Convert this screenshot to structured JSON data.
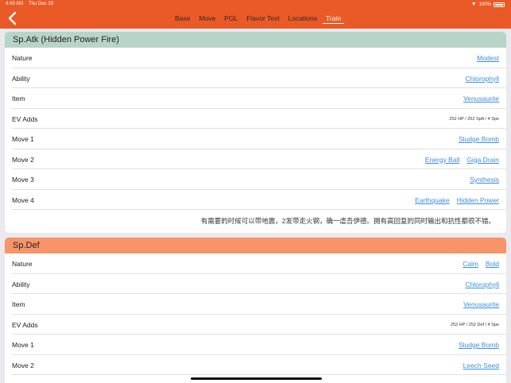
{
  "status": {
    "time": "4:43 AM",
    "date": "Thu Dec 19",
    "battery": "100%"
  },
  "nav": {
    "tabs": [
      "Base",
      "Move",
      "PGL",
      "Flavor Text",
      "Locations",
      "Train"
    ],
    "active_tab": "Train"
  },
  "colors": {
    "accent": "#ea5a26",
    "header_spatk": "#b7d4c9",
    "header_spdef": "#f7946a",
    "link": "#3a8ee0"
  },
  "builds": [
    {
      "title": "Sp.Atk (Hidden Power Fire)",
      "rows": [
        {
          "label": "Nature",
          "values": [
            "Modest"
          ]
        },
        {
          "label": "Ability",
          "values": [
            "Chlorophyll"
          ]
        },
        {
          "label": "Item",
          "values": [
            "Venusaurite"
          ]
        },
        {
          "label": "EV Adds",
          "ev": "252 HP / 252 SpA / 4 Spe"
        },
        {
          "label": "Move 1",
          "values": [
            "Sludge Bomb"
          ]
        },
        {
          "label": "Move 2",
          "values": [
            "Energy Ball",
            "Giga Drain"
          ]
        },
        {
          "label": "Move 3",
          "values": [
            "Synthesis"
          ]
        },
        {
          "label": "Move 4",
          "values": [
            "Earthquake",
            "Hidden Power"
          ]
        }
      ],
      "note": "有需要的时候可以带地震，2发带走火钢，确一虐吾伊德。拥有高回复的同时输出和抗性都很不错。"
    },
    {
      "title": "Sp.Def",
      "rows": [
        {
          "label": "Nature",
          "values": [
            "Calm",
            "Bold"
          ]
        },
        {
          "label": "Ability",
          "values": [
            "Chlorophyll"
          ]
        },
        {
          "label": "Item",
          "values": [
            "Venusaurite"
          ]
        },
        {
          "label": "EV Adds",
          "ev": "252 HP / 252 Def / 4 Spe"
        },
        {
          "label": "Move 1",
          "values": [
            "Sludge Bomb"
          ]
        },
        {
          "label": "Move 2",
          "values": [
            "Leech Seed"
          ]
        }
      ]
    }
  ]
}
